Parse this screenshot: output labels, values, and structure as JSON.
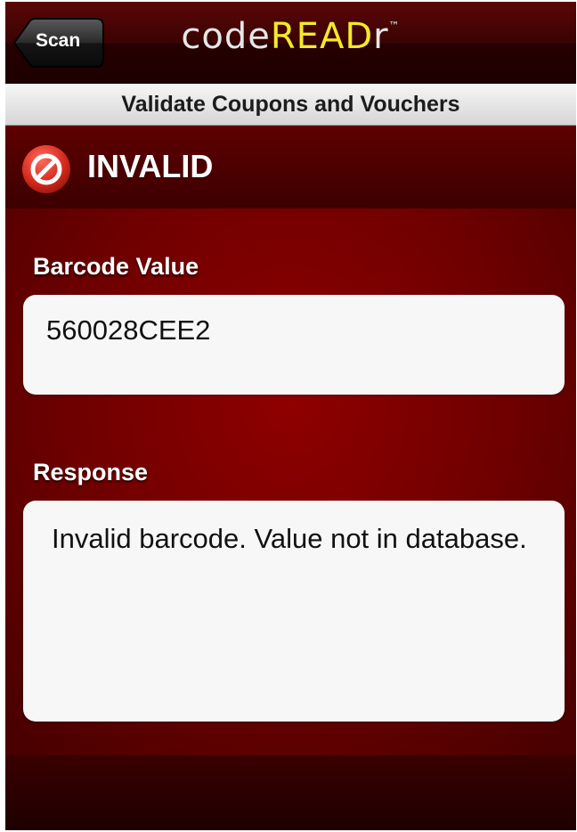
{
  "navbar": {
    "back_label": "Scan",
    "logo_part1": "code",
    "logo_part2": "READ",
    "logo_part3": "r",
    "logo_tm": "™"
  },
  "subtitle": "Validate Coupons and Vouchers",
  "status": {
    "icon": "prohibited-icon",
    "text": "INVALID"
  },
  "barcode": {
    "label": "Barcode Value",
    "value": "560028CEE2"
  },
  "response": {
    "label": "Response",
    "value": "Invalid barcode. Value not in database."
  },
  "colors": {
    "background": "#7a0000",
    "logo_accent": "#f2ea2a",
    "status_icon": "#d52b1e"
  }
}
